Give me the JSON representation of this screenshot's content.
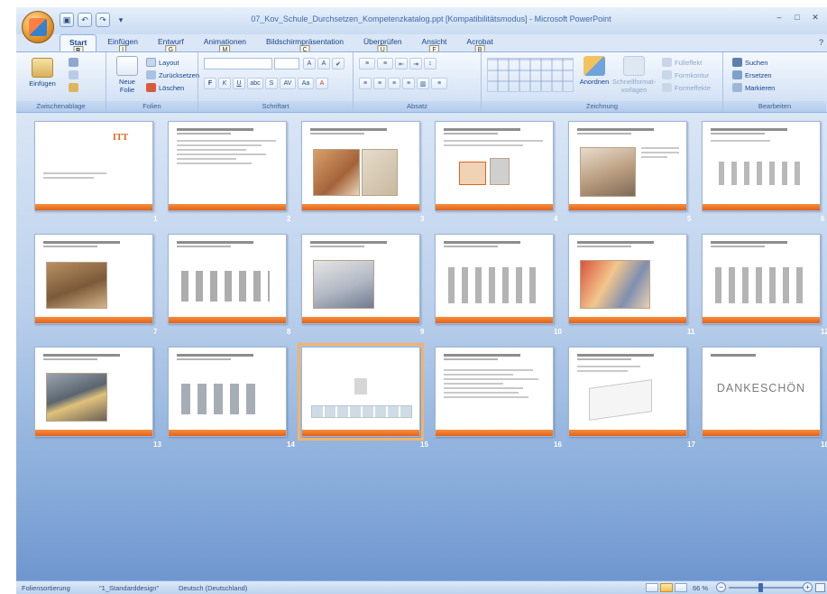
{
  "window": {
    "title": "07_Kov_Schule_Durchsetzen_Kompetenzkatalog.ppt [Kompatibilitätsmodus] - Microsoft PowerPoint",
    "help_glyph": "?"
  },
  "qat": {
    "save": "▣",
    "undo": "↶",
    "redo": "↷",
    "customize": "▾"
  },
  "win_controls": {
    "minimize": "–",
    "maximize": "□",
    "close": "✕"
  },
  "tabs": [
    {
      "label": "Start",
      "keytip": "R",
      "active": true
    },
    {
      "label": "Einfügen",
      "keytip": "I"
    },
    {
      "label": "Entwurf",
      "keytip": "G"
    },
    {
      "label": "Animationen",
      "keytip": "M"
    },
    {
      "label": "Bildschirmpräsentation",
      "keytip": "C"
    },
    {
      "label": "Überprüfen",
      "keytip": "Ü"
    },
    {
      "label": "Ansicht",
      "keytip": "F"
    },
    {
      "label": "Acrobat",
      "keytip": "B"
    }
  ],
  "ribbon": {
    "clipboard": {
      "label": "Zwischenablage",
      "paste": "Einfügen"
    },
    "slides": {
      "label": "Folien",
      "new_slide": "Neue Folie",
      "layout": "Layout",
      "reset": "Zurücksetzen",
      "delete": "Löschen"
    },
    "font": {
      "label": "Schriftart",
      "tools_row1": [
        "A",
        "A",
        "✔"
      ],
      "tools_row2": [
        "F",
        "K",
        "U",
        "abc",
        "S",
        "AV",
        "Aa",
        "A"
      ]
    },
    "paragraph": {
      "label": "Absatz",
      "tools_row1": [
        "≡",
        "≡",
        "⇤",
        "⇥",
        "↕"
      ],
      "tools_row2": [
        "≡",
        "≡",
        "≡",
        "≡",
        "▥",
        "≡"
      ]
    },
    "drawing": {
      "label": "Zeichnung",
      "arrange": "Anordnen",
      "quick_styles": "Schnellformat-vorlagen",
      "fill": "Fülleffekt",
      "outline": "Formkontur",
      "effects": "Formeffekte"
    },
    "editing": {
      "label": "Bearbeiten",
      "find": "Suchen",
      "replace": "Ersetzen",
      "select": "Markieren"
    }
  },
  "slides": [
    {
      "number": "1",
      "type": "title"
    },
    {
      "number": "2",
      "type": "text"
    },
    {
      "number": "3",
      "type": "photo"
    },
    {
      "number": "4",
      "type": "text-image"
    },
    {
      "number": "5",
      "type": "photo"
    },
    {
      "number": "6",
      "type": "diagram"
    },
    {
      "number": "7",
      "type": "photo"
    },
    {
      "number": "8",
      "type": "diagram"
    },
    {
      "number": "9",
      "type": "photo"
    },
    {
      "number": "10",
      "type": "diagram"
    },
    {
      "number": "11",
      "type": "photo"
    },
    {
      "number": "12",
      "type": "diagram"
    },
    {
      "number": "13",
      "type": "photo"
    },
    {
      "number": "14",
      "type": "diagram"
    },
    {
      "number": "15",
      "type": "table",
      "selected": true
    },
    {
      "number": "16",
      "type": "text"
    },
    {
      "number": "17",
      "type": "text-image"
    },
    {
      "number": "18",
      "type": "closing",
      "text": "DANKESCHÖN"
    }
  ],
  "title_slide": {
    "logo": "ITT"
  },
  "statusbar": {
    "view": "Foliensortierung",
    "theme": "\"1_Standarddesign\"",
    "language": "Deutsch (Deutschland)",
    "zoom": "66 %",
    "zoom_minus": "−",
    "zoom_plus": "+"
  },
  "colors": {
    "accent": "#e4621a",
    "ribbon_text": "#15428b",
    "selection": "#f3b36a"
  }
}
